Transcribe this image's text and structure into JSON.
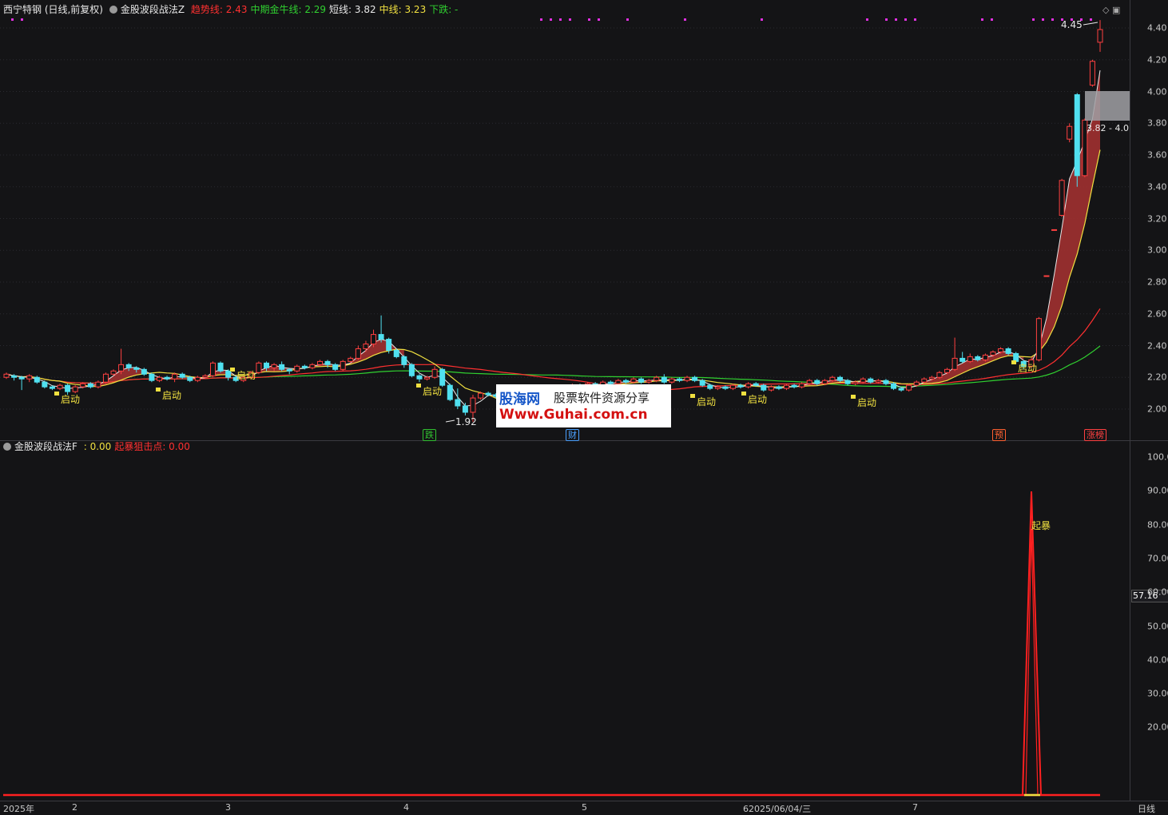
{
  "main_legend": {
    "stock": "西宁特钢 (日线,前复权)",
    "indicator": "金股波段战法Z",
    "items": [
      {
        "label": "趋势线",
        "value": "2.43",
        "color": "#ff3030"
      },
      {
        "label": "中期金牛线",
        "value": "2.29",
        "color": "#30d030"
      },
      {
        "label": "短线",
        "value": "3.82",
        "color": "#e8e8e8"
      },
      {
        "label": "中线",
        "value": "3.23",
        "color": "#f0e040"
      },
      {
        "label": "下跌",
        "value": "-",
        "color": "#30d030"
      }
    ]
  },
  "sub_legend": {
    "indicator": "金股波段战法F",
    "items": [
      {
        "label": "",
        "value": "0.00",
        "color": "#f0e040"
      },
      {
        "label": "起暴狙击点",
        "value": "0.00",
        "color": "#ff3030"
      }
    ]
  },
  "main_axis": [
    "4.40",
    "4.20",
    "4.00",
    "3.80",
    "3.60",
    "3.40",
    "3.20",
    "3.00",
    "2.80",
    "2.60",
    "2.40",
    "2.20",
    "2.00"
  ],
  "sub_axis": [
    "100.0",
    "90.00",
    "80.00",
    "70.00",
    "60.00",
    "50.00",
    "40.00",
    "30.00",
    "20.00"
  ],
  "x_ticks": [
    "2025年",
    "2",
    "3",
    "4",
    "5",
    "62025/06/04/三",
    "7"
  ],
  "period": "日线",
  "cursor_value": "57.16",
  "annotations": {
    "high": "4.45",
    "low": "1.92",
    "range": "3.82 - 4.0",
    "qibao": "起暴",
    "start": "启动"
  },
  "badges": [
    {
      "text": "跌",
      "color": "#30c030"
    },
    {
      "text": "财",
      "color": "#4aa0ff"
    },
    {
      "text": "预",
      "color": "#ff6030"
    },
    {
      "text": "涨榜",
      "color": "#ff4040"
    }
  ],
  "watermark": {
    "brand": "股海网",
    "slogan": "股票软件资源分享",
    "url": "Www.Guhai.com.cn"
  },
  "colors": {
    "up": "#ff4040",
    "down": "#50e0f0",
    "fill": "#a03030",
    "green": "#30d030",
    "yellow": "#f0e040"
  },
  "chart_data": {
    "type": "candlestick",
    "y_range": [
      1.85,
      4.5
    ],
    "candles": [
      [
        2.2,
        2.22,
        2.19,
        2.23
      ],
      [
        2.21,
        2.2,
        2.18,
        2.22
      ],
      [
        2.2,
        2.19,
        2.12,
        2.21
      ],
      [
        2.19,
        2.21,
        2.17,
        2.22
      ],
      [
        2.2,
        2.17,
        2.16,
        2.21
      ],
      [
        2.17,
        2.14,
        2.13,
        2.18
      ],
      [
        2.14,
        2.13,
        2.12,
        2.15
      ],
      [
        2.13,
        2.15,
        2.12,
        2.16
      ],
      [
        2.15,
        2.11,
        2.09,
        2.16
      ],
      [
        2.11,
        2.14,
        2.1,
        2.15
      ],
      [
        2.14,
        2.16,
        2.13,
        2.17
      ],
      [
        2.16,
        2.14,
        2.13,
        2.17
      ],
      [
        2.14,
        2.17,
        2.13,
        2.18
      ],
      [
        2.17,
        2.22,
        2.16,
        2.23
      ],
      [
        2.22,
        2.24,
        2.21,
        2.25
      ],
      [
        2.24,
        2.28,
        2.22,
        2.38
      ],
      [
        2.28,
        2.26,
        2.24,
        2.29
      ],
      [
        2.26,
        2.25,
        2.23,
        2.27
      ],
      [
        2.25,
        2.22,
        2.21,
        2.26
      ],
      [
        2.22,
        2.18,
        2.17,
        2.23
      ],
      [
        2.18,
        2.2,
        2.17,
        2.21
      ],
      [
        2.2,
        2.19,
        2.18,
        2.21
      ],
      [
        2.19,
        2.22,
        2.17,
        2.23
      ],
      [
        2.22,
        2.2,
        2.19,
        2.23
      ],
      [
        2.2,
        2.18,
        2.17,
        2.21
      ],
      [
        2.18,
        2.2,
        2.17,
        2.21
      ],
      [
        2.2,
        2.21,
        2.19,
        2.22
      ],
      [
        2.21,
        2.29,
        2.2,
        2.3
      ],
      [
        2.29,
        2.24,
        2.23,
        2.3
      ],
      [
        2.24,
        2.2,
        2.18,
        2.25
      ],
      [
        2.2,
        2.18,
        2.17,
        2.21
      ],
      [
        2.18,
        2.2,
        2.17,
        2.21
      ],
      [
        2.2,
        2.23,
        2.19,
        2.24
      ],
      [
        2.23,
        2.29,
        2.22,
        2.3
      ],
      [
        2.29,
        2.26,
        2.24,
        2.3
      ],
      [
        2.26,
        2.28,
        2.24,
        2.29
      ],
      [
        2.28,
        2.25,
        2.24,
        2.3
      ],
      [
        2.25,
        2.24,
        2.22,
        2.26
      ],
      [
        2.24,
        2.27,
        2.23,
        2.28
      ],
      [
        2.27,
        2.26,
        2.25,
        2.28
      ],
      [
        2.26,
        2.28,
        2.25,
        2.29
      ],
      [
        2.28,
        2.3,
        2.27,
        2.31
      ],
      [
        2.3,
        2.28,
        2.26,
        2.31
      ],
      [
        2.28,
        2.25,
        2.24,
        2.29
      ],
      [
        2.25,
        2.3,
        2.24,
        2.31
      ],
      [
        2.3,
        2.32,
        2.29,
        2.33
      ],
      [
        2.32,
        2.38,
        2.31,
        2.4
      ],
      [
        2.38,
        2.41,
        2.36,
        2.43
      ],
      [
        2.41,
        2.47,
        2.39,
        2.5
      ],
      [
        2.47,
        2.44,
        2.42,
        2.59
      ],
      [
        2.44,
        2.37,
        2.35,
        2.45
      ],
      [
        2.37,
        2.33,
        2.32,
        2.38
      ],
      [
        2.33,
        2.28,
        2.26,
        2.34
      ],
      [
        2.28,
        2.21,
        2.2,
        2.29
      ],
      [
        2.21,
        2.19,
        2.17,
        2.22
      ],
      [
        2.19,
        2.2,
        2.18,
        2.21
      ],
      [
        2.2,
        2.25,
        2.19,
        2.27
      ],
      [
        2.25,
        2.15,
        2.14,
        2.26
      ],
      [
        2.15,
        2.06,
        2.05,
        2.16
      ],
      [
        2.06,
        2.02,
        2.0,
        2.13
      ],
      [
        2.02,
        1.98,
        1.96,
        2.04
      ],
      [
        1.98,
        2.07,
        1.92,
        2.09
      ],
      [
        2.07,
        2.1,
        2.06,
        2.11
      ],
      [
        2.1,
        2.09,
        2.08,
        2.11
      ],
      [
        2.09,
        2.08,
        2.07,
        2.1
      ],
      [
        2.08,
        2.1,
        2.07,
        2.11
      ],
      [
        2.1,
        2.11,
        2.09,
        2.12
      ],
      [
        2.11,
        2.09,
        2.08,
        2.12
      ],
      [
        2.09,
        2.06,
        2.05,
        2.1
      ],
      [
        2.06,
        2.08,
        2.05,
        2.09
      ],
      [
        2.08,
        2.1,
        2.07,
        2.11
      ],
      [
        2.1,
        2.12,
        2.09,
        2.13
      ],
      [
        2.12,
        2.14,
        2.11,
        2.15
      ],
      [
        2.14,
        2.13,
        2.12,
        2.15
      ],
      [
        2.13,
        2.15,
        2.12,
        2.16
      ],
      [
        2.15,
        2.14,
        2.13,
        2.16
      ],
      [
        2.14,
        2.16,
        2.13,
        2.17
      ],
      [
        2.16,
        2.15,
        2.14,
        2.17
      ],
      [
        2.15,
        2.17,
        2.14,
        2.18
      ],
      [
        2.17,
        2.16,
        2.15,
        2.18
      ],
      [
        2.16,
        2.18,
        2.15,
        2.19
      ],
      [
        2.18,
        2.17,
        2.16,
        2.19
      ],
      [
        2.17,
        2.19,
        2.16,
        2.2
      ],
      [
        2.19,
        2.17,
        2.16,
        2.2
      ],
      [
        2.17,
        2.18,
        2.16,
        2.19
      ],
      [
        2.18,
        2.2,
        2.17,
        2.21
      ],
      [
        2.2,
        2.17,
        2.16,
        2.22
      ],
      [
        2.17,
        2.19,
        2.16,
        2.2
      ],
      [
        2.19,
        2.18,
        2.17,
        2.2
      ],
      [
        2.18,
        2.2,
        2.17,
        2.21
      ],
      [
        2.2,
        2.18,
        2.17,
        2.21
      ],
      [
        2.18,
        2.15,
        2.14,
        2.19
      ],
      [
        2.15,
        2.13,
        2.12,
        2.16
      ],
      [
        2.13,
        2.14,
        2.12,
        2.15
      ],
      [
        2.14,
        2.13,
        2.12,
        2.15
      ],
      [
        2.13,
        2.15,
        2.12,
        2.16
      ],
      [
        2.15,
        2.14,
        2.13,
        2.16
      ],
      [
        2.14,
        2.16,
        2.13,
        2.17
      ],
      [
        2.16,
        2.15,
        2.14,
        2.17
      ],
      [
        2.15,
        2.12,
        2.11,
        2.16
      ],
      [
        2.12,
        2.14,
        2.11,
        2.15
      ],
      [
        2.14,
        2.13,
        2.12,
        2.15
      ],
      [
        2.13,
        2.15,
        2.12,
        2.16
      ],
      [
        2.15,
        2.14,
        2.13,
        2.16
      ],
      [
        2.14,
        2.16,
        2.13,
        2.17
      ],
      [
        2.16,
        2.18,
        2.15,
        2.19
      ],
      [
        2.18,
        2.16,
        2.15,
        2.19
      ],
      [
        2.16,
        2.18,
        2.15,
        2.19
      ],
      [
        2.18,
        2.2,
        2.17,
        2.21
      ],
      [
        2.2,
        2.18,
        2.17,
        2.21
      ],
      [
        2.18,
        2.16,
        2.15,
        2.19
      ],
      [
        2.16,
        2.17,
        2.15,
        2.18
      ],
      [
        2.17,
        2.19,
        2.16,
        2.2
      ],
      [
        2.19,
        2.17,
        2.16,
        2.2
      ],
      [
        2.17,
        2.18,
        2.16,
        2.19
      ],
      [
        2.18,
        2.16,
        2.15,
        2.19
      ],
      [
        2.16,
        2.13,
        2.12,
        2.17
      ],
      [
        2.13,
        2.12,
        2.11,
        2.14
      ],
      [
        2.12,
        2.15,
        2.11,
        2.16
      ],
      [
        2.15,
        2.17,
        2.14,
        2.18
      ],
      [
        2.17,
        2.19,
        2.16,
        2.2
      ],
      [
        2.19,
        2.2,
        2.18,
        2.21
      ],
      [
        2.2,
        2.23,
        2.19,
        2.24
      ],
      [
        2.23,
        2.25,
        2.22,
        2.26
      ],
      [
        2.25,
        2.32,
        2.24,
        2.45
      ],
      [
        2.32,
        2.3,
        2.29,
        2.36
      ],
      [
        2.3,
        2.33,
        2.29,
        2.35
      ],
      [
        2.33,
        2.31,
        2.3,
        2.34
      ],
      [
        2.31,
        2.34,
        2.3,
        2.35
      ],
      [
        2.34,
        2.36,
        2.33,
        2.37
      ],
      [
        2.36,
        2.38,
        2.35,
        2.39
      ],
      [
        2.38,
        2.35,
        2.34,
        2.39
      ],
      [
        2.35,
        2.3,
        2.29,
        2.36
      ],
      [
        2.3,
        2.27,
        2.25,
        2.31
      ],
      [
        2.27,
        2.31,
        2.26,
        2.32
      ],
      [
        2.31,
        2.57,
        2.3,
        2.58
      ],
      [
        2.84,
        2.84,
        2.84,
        2.84
      ],
      [
        3.13,
        3.13,
        3.13,
        3.13
      ],
      [
        3.22,
        3.44,
        3.21,
        3.45
      ],
      [
        3.7,
        3.78,
        3.68,
        3.8
      ],
      [
        3.98,
        3.47,
        3.4,
        3.99
      ],
      [
        3.47,
        3.82,
        3.46,
        3.83
      ],
      [
        4.04,
        4.19,
        4.03,
        4.2
      ],
      [
        4.31,
        4.39,
        4.25,
        4.45
      ]
    ]
  }
}
